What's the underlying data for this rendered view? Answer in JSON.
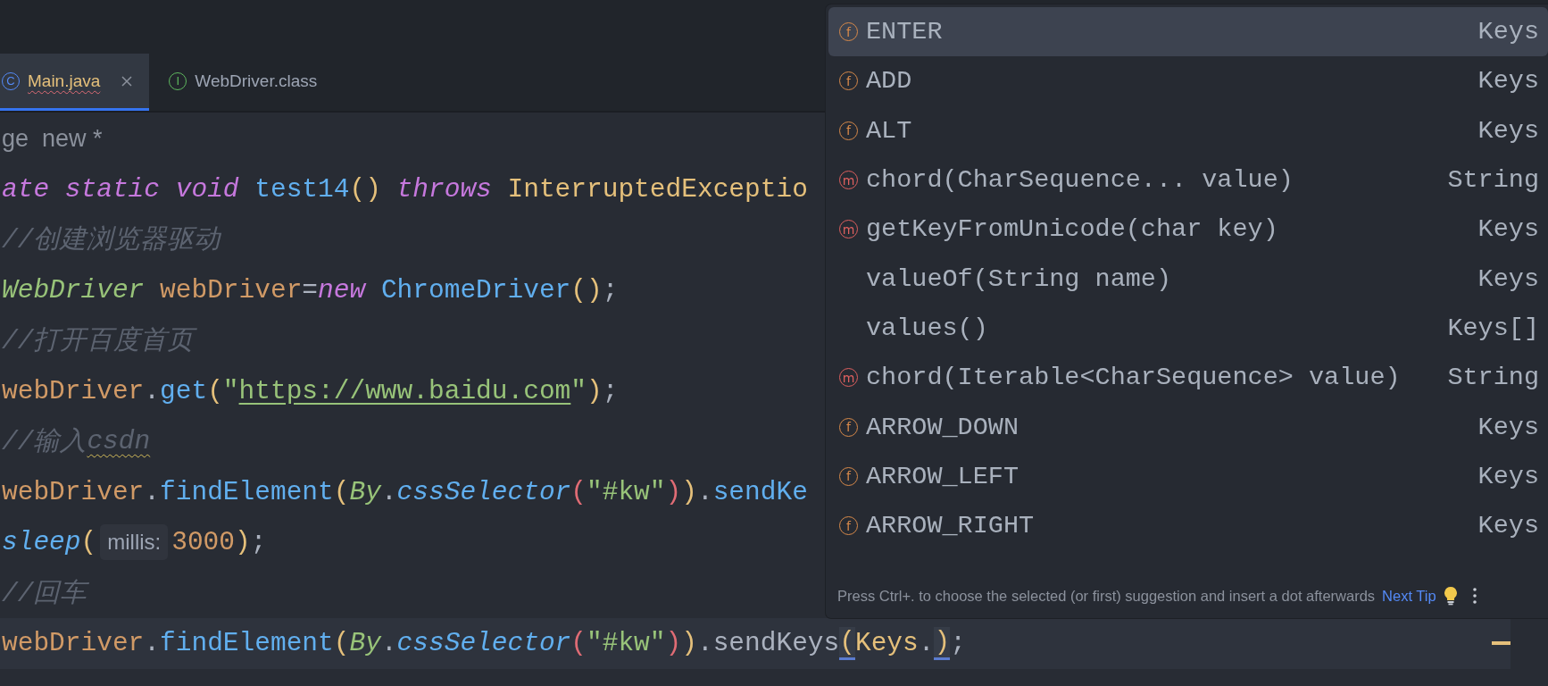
{
  "tabs": [
    {
      "icon_letter": "C",
      "color": "#548af7",
      "label": "Main.java",
      "selected": true,
      "closable": true,
      "error": true
    },
    {
      "icon_letter": "I",
      "color": "#5fb85f",
      "label": "WebDriver.class",
      "selected": false,
      "closable": false,
      "error": false
    }
  ],
  "editor": {
    "lines": [
      {
        "current": false,
        "tokens": [
          {
            "text": "ge  new *",
            "kind": "inlay"
          }
        ]
      },
      {
        "current": false,
        "tokens": [
          {
            "text": "ate static void ",
            "kind": "keyword"
          },
          {
            "text": "test14",
            "kind": "method"
          },
          {
            "text": "() ",
            "kind": "paren"
          },
          {
            "text": "throws ",
            "kind": "keyword"
          },
          {
            "text": "InterruptedExceptio",
            "kind": "type"
          }
        ]
      },
      {
        "current": false,
        "tokens": [
          {
            "text": "//创建浏览器驱动",
            "kind": "comment"
          }
        ]
      },
      {
        "current": false,
        "tokens": [
          {
            "text": "WebDriver ",
            "kind": "class-italic"
          },
          {
            "text": "webDriver",
            "kind": "var"
          },
          {
            "text": "=",
            "kind": "plain"
          },
          {
            "text": "new ",
            "kind": "keyword"
          },
          {
            "text": "ChromeDriver",
            "kind": "class"
          },
          {
            "text": "()",
            "kind": "paren"
          },
          {
            "text": ";",
            "kind": "plain"
          }
        ]
      },
      {
        "current": false,
        "tokens": [
          {
            "text": "//打开百度首页",
            "kind": "comment"
          }
        ]
      },
      {
        "current": false,
        "tokens": [
          {
            "text": "webDriver",
            "kind": "var"
          },
          {
            "text": ".",
            "kind": "plain"
          },
          {
            "text": "get",
            "kind": "method"
          },
          {
            "text": "(",
            "kind": "paren"
          },
          {
            "text": "\"",
            "kind": "string"
          },
          {
            "text": "https://www.baidu.com",
            "kind": "url"
          },
          {
            "text": "\"",
            "kind": "string"
          },
          {
            "text": ")",
            "kind": "paren"
          },
          {
            "text": ";",
            "kind": "plain"
          }
        ]
      },
      {
        "current": false,
        "tokens": [
          {
            "text": "//输入",
            "kind": "comment"
          },
          {
            "text": "csdn",
            "kind": "typo"
          }
        ]
      },
      {
        "current": false,
        "tokens": [
          {
            "text": "webDriver",
            "kind": "var"
          },
          {
            "text": ".",
            "kind": "plain"
          },
          {
            "text": "findElement",
            "kind": "method"
          },
          {
            "text": "(",
            "kind": "paren"
          },
          {
            "text": "By",
            "kind": "class-italic"
          },
          {
            "text": ".",
            "kind": "plain"
          },
          {
            "text": "cssSelector",
            "kind": "method-italic"
          },
          {
            "text": "(",
            "kind": "paren-red"
          },
          {
            "text": "\"#kw\"",
            "kind": "string"
          },
          {
            "text": ")",
            "kind": "paren-red"
          },
          {
            "text": ")",
            "kind": "paren"
          },
          {
            "text": ".",
            "kind": "plain"
          },
          {
            "text": "sendKe",
            "kind": "method"
          }
        ]
      },
      {
        "current": false,
        "tokens": [
          {
            "text": "sleep",
            "kind": "method-italic"
          },
          {
            "text": "(",
            "kind": "paren"
          },
          {
            "text": "millis:",
            "kind": "hint"
          },
          {
            "text": "3000",
            "kind": "number"
          },
          {
            "text": ")",
            "kind": "paren"
          },
          {
            "text": ";",
            "kind": "plain"
          }
        ]
      },
      {
        "current": false,
        "tokens": [
          {
            "text": "//回车",
            "kind": "comment"
          }
        ]
      },
      {
        "current": true,
        "tokens": [
          {
            "text": "webDriver",
            "kind": "var"
          },
          {
            "text": ".",
            "kind": "plain"
          },
          {
            "text": "findElement",
            "kind": "method"
          },
          {
            "text": "(",
            "kind": "paren"
          },
          {
            "text": "By",
            "kind": "class-italic"
          },
          {
            "text": ".",
            "kind": "plain"
          },
          {
            "text": "cssSelector",
            "kind": "method-italic"
          },
          {
            "text": "(",
            "kind": "paren-red"
          },
          {
            "text": "\"#kw\"",
            "kind": "string"
          },
          {
            "text": ")",
            "kind": "paren-red"
          },
          {
            "text": ")",
            "kind": "paren"
          },
          {
            "text": ".sendKeys",
            "kind": "plain"
          },
          {
            "text": "(",
            "kind": "brace-match"
          },
          {
            "text": "Keys",
            "kind": "type"
          },
          {
            "text": ".",
            "kind": "plain"
          },
          {
            "text": ")",
            "kind": "brace-match"
          },
          {
            "text": ";",
            "kind": "plain"
          }
        ]
      }
    ]
  },
  "completion": {
    "items": [
      {
        "kind": "field",
        "badge": "f",
        "name": "ENTER",
        "type": "Keys",
        "selected": true
      },
      {
        "kind": "field",
        "badge": "f",
        "name": "ADD",
        "type": "Keys",
        "selected": false
      },
      {
        "kind": "field",
        "badge": "f",
        "name": "ALT",
        "type": "Keys",
        "selected": false
      },
      {
        "kind": "method",
        "badge": "m",
        "name": "chord(CharSequence... value)",
        "type": "String",
        "selected": false
      },
      {
        "kind": "method",
        "badge": "m",
        "name": "getKeyFromUnicode(char key)",
        "type": "Keys",
        "selected": false
      },
      {
        "kind": "plain",
        "name": "valueOf(String name)",
        "type": "Keys",
        "selected": false
      },
      {
        "kind": "plain",
        "name": "values()",
        "type": "Keys[]",
        "selected": false
      },
      {
        "kind": "method",
        "badge": "m",
        "name": "chord(Iterable<CharSequence> value)",
        "type": "String",
        "selected": false
      },
      {
        "kind": "field",
        "badge": "f",
        "name": "ARROW_DOWN",
        "type": "Keys",
        "selected": false
      },
      {
        "kind": "field",
        "badge": "f",
        "name": "ARROW_LEFT",
        "type": "Keys",
        "selected": false
      },
      {
        "kind": "field",
        "badge": "f",
        "name": "ARROW_RIGHT",
        "type": "Keys",
        "selected": false
      }
    ],
    "tip": "Press Ctrl+. to choose the selected (or first) suggestion and insert a dot afterwards",
    "tip_link": "Next Tip"
  }
}
